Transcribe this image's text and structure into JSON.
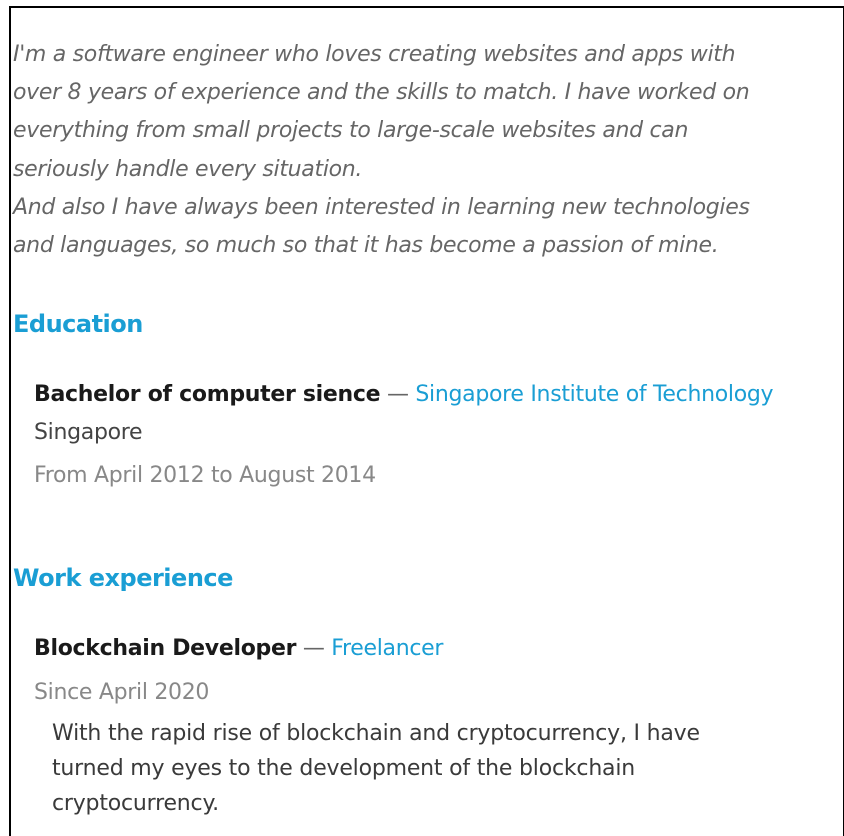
{
  "about": {
    "lines": [
      "I'm a software engineer who loves creating websites and apps with",
      "over 8 years of experience and the skills to match. I have worked on",
      "everything from small projects to large-scale websites and can",
      "seriously handle every situation.",
      "And also I have always been interested in learning new technologies",
      "and languages, so much so that it has become a passion of mine."
    ]
  },
  "education": {
    "heading": "Education",
    "entries": [
      {
        "title": "Bachelor of computer sience",
        "separator": "—",
        "institution": "Singapore Institute of Technology",
        "location": "Singapore",
        "period": "From April 2012 to August 2014"
      }
    ]
  },
  "work": {
    "heading": "Work experience",
    "entries": [
      {
        "title": "Blockchain Developer",
        "separator": "—",
        "company": "Freelancer",
        "period": "Since April 2020",
        "description_lines": [
          "With the rapid rise of blockchain and cryptocurrency, I have",
          "turned my eyes to the development of the blockchain",
          "cryptocurrency."
        ]
      }
    ]
  },
  "colors": {
    "accent": "#1a9ed4",
    "intro_text": "#666666",
    "muted_text": "#888888",
    "border": "#000000"
  }
}
